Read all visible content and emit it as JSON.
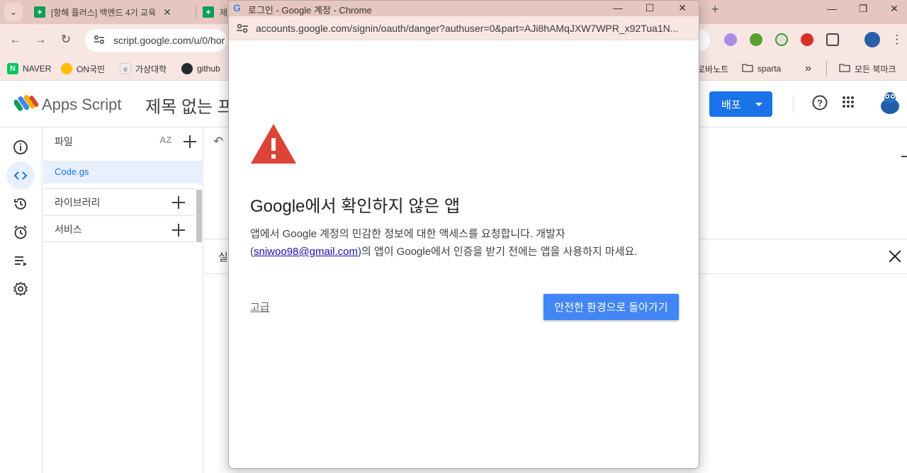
{
  "browser": {
    "tabs": [
      {
        "title": "[항해 플러스] 백엔드 4기 교육"
      },
      {
        "title": "제"
      }
    ],
    "address": "script.google.com/u/0/hor",
    "bookmarks": [
      {
        "label": "NAVER",
        "icon": "naver-icon"
      },
      {
        "label": "ON국민",
        "icon": "onkb-icon"
      },
      {
        "label": "가상대학",
        "icon": "cyber-univ-icon"
      },
      {
        "label": "github",
        "icon": "github-icon"
      },
      {
        "label": "로바노트",
        "icon": ""
      },
      {
        "label": "sparta",
        "icon": "folder-icon"
      },
      {
        "label": "모든 북마크",
        "icon": "folder-icon"
      }
    ]
  },
  "apps_script": {
    "product_name": "Apps Script",
    "project_title": "제목 없는 프",
    "deploy_label": "배포",
    "files_panel": {
      "heading": "파일",
      "sort_label": "AZ",
      "selected_file": "Code.gs",
      "libraries_label": "라이브러리",
      "services_label": "서비스"
    },
    "exec_label": "실"
  },
  "popup": {
    "window_title": "로그인 - Google 계정 - Chrome",
    "url": "accounts.google.com/signin/oauth/danger?authuser=0&part=AJi8hAMqJXW7WPR_x92Tua1N...",
    "heading": "Google에서 확인하지 않은 앱",
    "body_line1": "앱에서 Google 계정의 민감한 정보에 대한 액세스를 요청합니다. 개발자",
    "body_open": "(",
    "developer_email": "sniwoo98@gmail.com",
    "body_line2_rest": ")의 앱이 Google에서 인증을 받기 전에는 앱을 사용하지 마세요.",
    "advanced_label": "고급",
    "back_to_safety_label": "안전한 환경으로 돌아가기"
  },
  "colors": {
    "chrome_frame": "#e6c7bf",
    "primary_blue": "#1a73e8",
    "warning_red": "#db4437",
    "button_blue": "#4285f4"
  }
}
